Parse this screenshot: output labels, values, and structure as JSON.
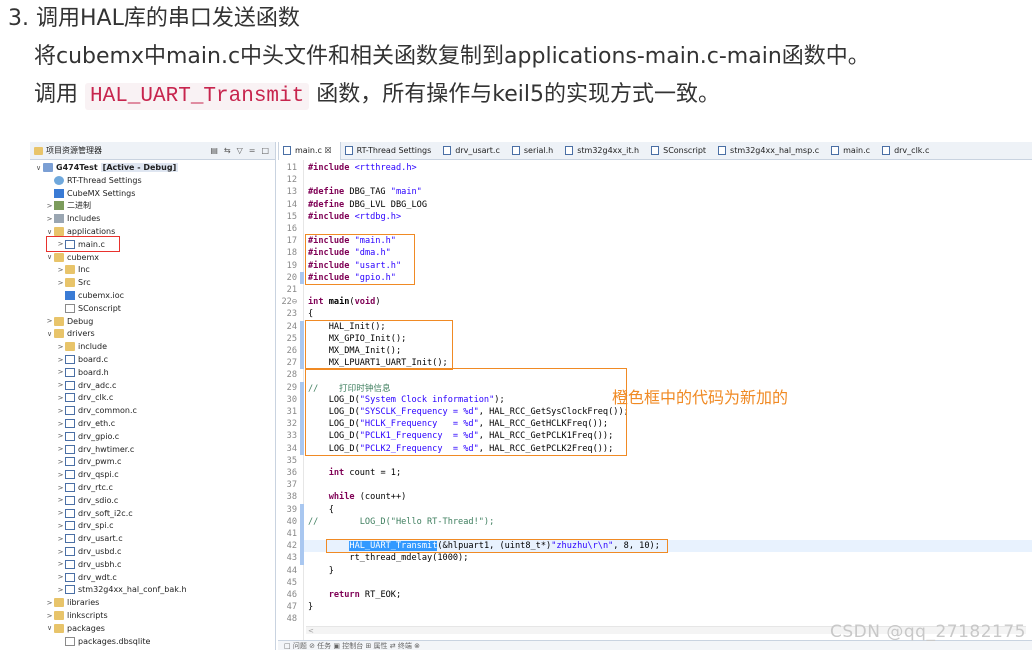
{
  "article": {
    "heading": "3. 调用HAL库的串口发送函数",
    "line2": "将cubemx中main.c中头文件和相关函数复制到applications-main.c-main函数中。",
    "line3_pre": "调用 ",
    "line3_code": "HAL_UART_Transmit",
    "line3_post": " 函数，所有操作与keil5的实现方式一致。"
  },
  "explorer": {
    "title": "项目资源管理器",
    "tools": [
      "▤",
      "⇆",
      "▽",
      "=",
      "□"
    ],
    "nodes": [
      {
        "label": "G474Test",
        "tag": "[Active - Debug]",
        "icon": "project",
        "tw": "∨",
        "indent": 0
      },
      {
        "label": "RT-Thread Settings",
        "icon": "gear",
        "tw": "",
        "indent": 1
      },
      {
        "label": "CubeMX Settings",
        "icon": "mx",
        "tw": "",
        "indent": 1
      },
      {
        "label": "二进制",
        "icon": "bin",
        "tw": ">",
        "indent": 1
      },
      {
        "label": "Includes",
        "icon": "inc",
        "tw": ">",
        "indent": 1
      },
      {
        "label": "applications",
        "icon": "folder",
        "tw": "∨",
        "indent": 1
      },
      {
        "label": "main.c",
        "icon": "cfile",
        "tw": ">",
        "indent": 2
      },
      {
        "label": "cubemx",
        "icon": "folder",
        "tw": "∨",
        "indent": 1
      },
      {
        "label": "Inc",
        "icon": "folder",
        "tw": ">",
        "indent": 2
      },
      {
        "label": "Src",
        "icon": "folder",
        "tw": ">",
        "indent": 2
      },
      {
        "label": "cubemx.ioc",
        "icon": "mx",
        "tw": "",
        "indent": 2
      },
      {
        "label": "SConscript",
        "icon": "file",
        "tw": "",
        "indent": 2
      },
      {
        "label": "Debug",
        "icon": "folder",
        "tw": ">",
        "indent": 1
      },
      {
        "label": "drivers",
        "icon": "folder",
        "tw": "∨",
        "indent": 1
      },
      {
        "label": "include",
        "icon": "folder",
        "tw": ">",
        "indent": 2
      },
      {
        "label": "board.c",
        "icon": "cfile",
        "tw": ">",
        "indent": 2
      },
      {
        "label": "board.h",
        "icon": "cfile",
        "tw": ">",
        "indent": 2
      },
      {
        "label": "drv_adc.c",
        "icon": "cfile",
        "tw": ">",
        "indent": 2
      },
      {
        "label": "drv_clk.c",
        "icon": "cfile",
        "tw": ">",
        "indent": 2
      },
      {
        "label": "drv_common.c",
        "icon": "cfile",
        "tw": ">",
        "indent": 2
      },
      {
        "label": "drv_eth.c",
        "icon": "cfile",
        "tw": ">",
        "indent": 2
      },
      {
        "label": "drv_gpio.c",
        "icon": "cfile",
        "tw": ">",
        "indent": 2
      },
      {
        "label": "drv_hwtimer.c",
        "icon": "cfile",
        "tw": ">",
        "indent": 2
      },
      {
        "label": "drv_pwm.c",
        "icon": "cfile",
        "tw": ">",
        "indent": 2
      },
      {
        "label": "drv_qspi.c",
        "icon": "cfile",
        "tw": ">",
        "indent": 2
      },
      {
        "label": "drv_rtc.c",
        "icon": "cfile",
        "tw": ">",
        "indent": 2
      },
      {
        "label": "drv_sdio.c",
        "icon": "cfile",
        "tw": ">",
        "indent": 2
      },
      {
        "label": "drv_soft_i2c.c",
        "icon": "cfile",
        "tw": ">",
        "indent": 2
      },
      {
        "label": "drv_spi.c",
        "icon": "cfile",
        "tw": ">",
        "indent": 2
      },
      {
        "label": "drv_usart.c",
        "icon": "cfile",
        "tw": ">",
        "indent": 2
      },
      {
        "label": "drv_usbd.c",
        "icon": "cfile",
        "tw": ">",
        "indent": 2
      },
      {
        "label": "drv_usbh.c",
        "icon": "cfile",
        "tw": ">",
        "indent": 2
      },
      {
        "label": "drv_wdt.c",
        "icon": "cfile",
        "tw": ">",
        "indent": 2
      },
      {
        "label": "stm32g4xx_hal_conf_bak.h",
        "icon": "cfile",
        "tw": ">",
        "indent": 2
      },
      {
        "label": "libraries",
        "icon": "folder",
        "tw": ">",
        "indent": 1
      },
      {
        "label": "linkscripts",
        "icon": "folder",
        "tw": ">",
        "indent": 1
      },
      {
        "label": "packages",
        "icon": "folder",
        "tw": "∨",
        "indent": 1
      },
      {
        "label": "packages.dbsqlite",
        "icon": "file",
        "tw": "",
        "indent": 2
      }
    ]
  },
  "tabs": [
    "main.c ☒",
    "RT-Thread Settings",
    "drv_usart.c",
    "serial.h",
    "stm32g4xx_it.h",
    "SConscript",
    "stm32g4xx_hal_msp.c",
    "main.c",
    "drv_clk.c"
  ],
  "code_lines": [
    {
      "n": "11",
      "html": "<span class='kw'>#include</span> <span class='str'>&lt;rtthread.h&gt;</span>"
    },
    {
      "n": "12",
      "html": ""
    },
    {
      "n": "13",
      "html": "<span class='kw'>#define</span> DBG_TAG <span class='str'>\"main\"</span>"
    },
    {
      "n": "14",
      "html": "<span class='kw'>#define</span> DBG_LVL DBG_LOG"
    },
    {
      "n": "15",
      "html": "<span class='kw'>#include</span> <span class='str'>&lt;rtdbg.h&gt;</span>"
    },
    {
      "n": "16",
      "html": ""
    },
    {
      "n": "17",
      "html": "<span class='kw'>#include</span> <span class='str'>\"main.h\"</span>"
    },
    {
      "n": "18",
      "html": "<span class='kw'>#include</span> <span class='str'>\"dma.h\"</span>"
    },
    {
      "n": "19",
      "html": "<span class='kw'>#include</span> <span class='str'>\"usart.h\"</span>"
    },
    {
      "n": "20",
      "html": "<span class='kw'>#include</span> <span class='str'>\"gpio.h\"</span>"
    },
    {
      "n": "21",
      "html": ""
    },
    {
      "n": "22⊖",
      "html": "<span class='kw'>int</span> <b>main</b>(<span class='kw'>void</span>)"
    },
    {
      "n": "23",
      "html": "{"
    },
    {
      "n": "24",
      "html": "    HAL_Init();"
    },
    {
      "n": "25",
      "html": "    MX_GPIO_Init();"
    },
    {
      "n": "26",
      "html": "    MX_DMA_Init();"
    },
    {
      "n": "27",
      "html": "    MX_LPUART1_UART_Init();"
    },
    {
      "n": "28",
      "html": ""
    },
    {
      "n": "29",
      "html": "<span class='cmt'>//    打印时钟信息</span>"
    },
    {
      "n": "30",
      "html": "    LOG_D(<span class='str'>\"System Clock information\"</span>);"
    },
    {
      "n": "31",
      "html": "    LOG_D(<span class='str'>\"SYSCLK_Frequency = %d\"</span>, HAL_RCC_GetSysClockFreq());"
    },
    {
      "n": "32",
      "html": "    LOG_D(<span class='str'>\"HCLK_Frequency   = %d\"</span>, HAL_RCC_GetHCLKFreq());"
    },
    {
      "n": "33",
      "html": "    LOG_D(<span class='str'>\"PCLK1_Frequency  = %d\"</span>, HAL_RCC_GetPCLK1Freq());"
    },
    {
      "n": "34",
      "html": "    LOG_D(<span class='str'>\"PCLK2_Frequency  = %d\"</span>, HAL_RCC_GetPCLK2Freq());"
    },
    {
      "n": "35",
      "html": ""
    },
    {
      "n": "36",
      "html": "    <span class='kw'>int</span> count = 1;"
    },
    {
      "n": "37",
      "html": ""
    },
    {
      "n": "38",
      "html": "    <span class='kw'>while</span> (count++)"
    },
    {
      "n": "39",
      "html": "    {"
    },
    {
      "n": "40",
      "html": "<span class='cmt'>//        LOG_D(\"Hello RT-Thread!\");</span>"
    },
    {
      "n": "41",
      "html": ""
    },
    {
      "n": "42",
      "html": "        <span class='sel'>HAL_UART_Transmit</span>(&amp;hlpuart1, (uint8_t*)<span class='str'>\"zhuzhu\\r\\n\"</span>, 8, 10);"
    },
    {
      "n": "43",
      "html": "        rt_thread_mdelay(1000);"
    },
    {
      "n": "44",
      "html": "    }"
    },
    {
      "n": "45",
      "html": ""
    },
    {
      "n": "46",
      "html": "    <span class='kw'>return</span> RT_EOK;"
    },
    {
      "n": "47",
      "html": "}"
    },
    {
      "n": "48",
      "html": ""
    }
  ],
  "annotation": "橙色框中的代码为新加的",
  "watermark": "CSDN @qq_27182175",
  "scroll_arrow": "<",
  "status_text": "□ 问题  ⊘ 任务  ▣ 控制台  ⊞ 属性  ⇄ 终端  ⊗",
  "colors": {
    "orange": "#f08a24",
    "red": "#e8322d",
    "keyword": "#7f0055",
    "string": "#2a00ff",
    "comment": "#3f7f5f"
  }
}
